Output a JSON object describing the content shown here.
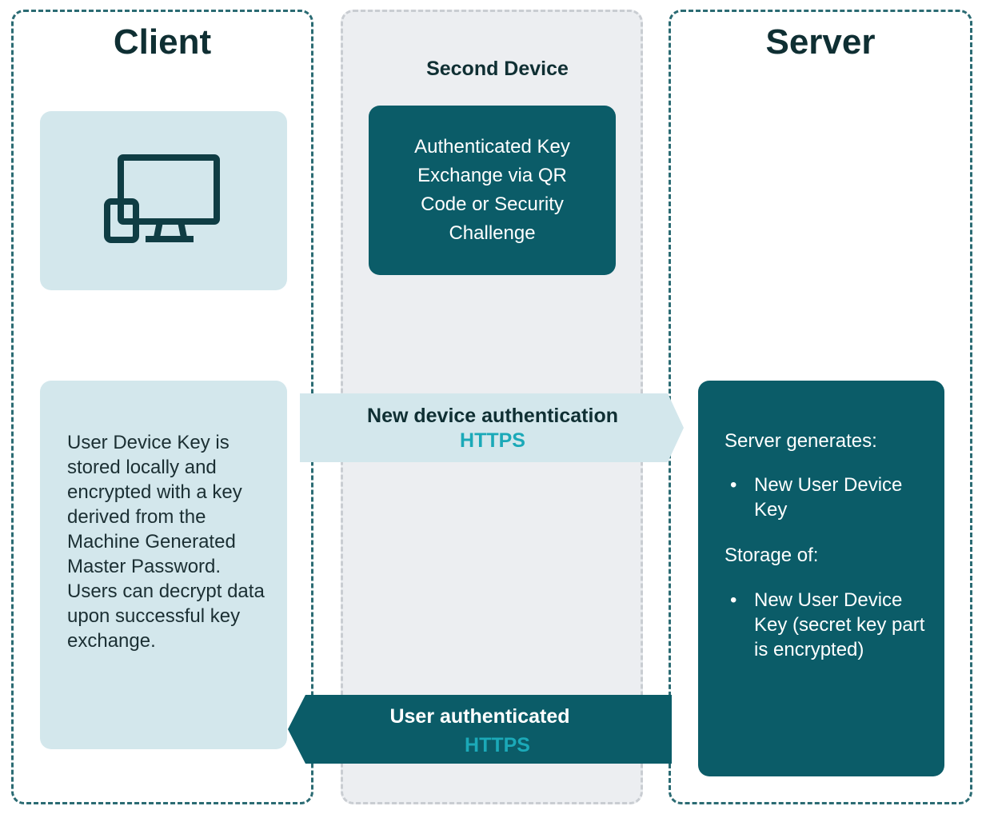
{
  "columns": {
    "client": {
      "title": "Client"
    },
    "second_device": {
      "title": "Second Device"
    },
    "server": {
      "title": "Server"
    }
  },
  "client": {
    "device_icon": "desktop-and-phone-icon",
    "note": "User Device Key is stored locally and encrypted with a key derived from the Machine Generated Master Password. Users can decrypt data upon successful key exchange."
  },
  "second_device": {
    "box_text": "Authenticated Key Exchange via QR Code or Security Challenge"
  },
  "arrows": {
    "to_server": {
      "label": "New device authentication",
      "protocol": "HTTPS"
    },
    "to_client": {
      "label": "User authenticated",
      "protocol": "HTTPS"
    }
  },
  "server": {
    "generates_heading": "Server generates:",
    "generates_items": [
      "New User Device Key"
    ],
    "storage_heading": "Storage of:",
    "storage_items": [
      "New User Device Key (secret key part is encrypted)"
    ]
  },
  "colors": {
    "teal_dark": "#0b5c68",
    "teal_light": "#d3e7ec",
    "accent": "#1ba9b8",
    "lane_gray": "#eceef1"
  }
}
